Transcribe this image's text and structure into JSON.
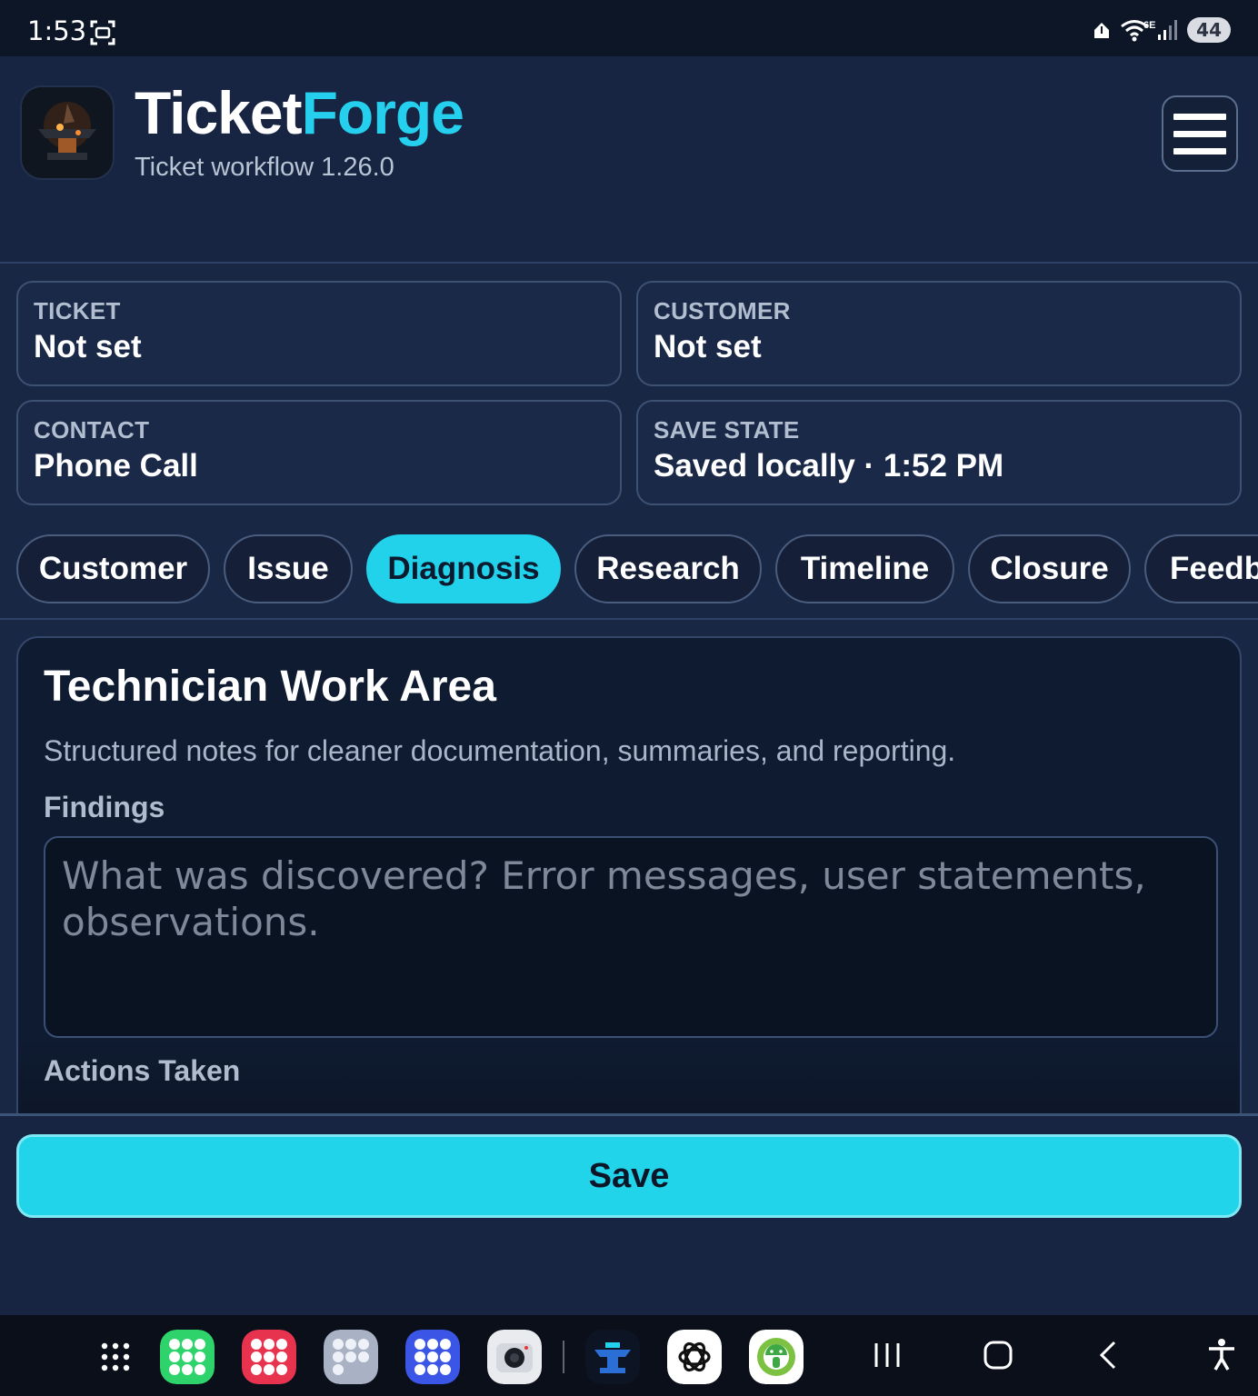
{
  "status_bar": {
    "time": "1:53",
    "network_label": "6E",
    "battery": "44"
  },
  "header": {
    "title_part1": "Ticket",
    "title_part2": "Forge",
    "subtitle": "Ticket workflow 1.26.0",
    "accent_color": "#25d0ee"
  },
  "info_cards": [
    {
      "label": "TICKET",
      "value": "Not set"
    },
    {
      "label": "CUSTOMER",
      "value": "Not set"
    },
    {
      "label": "CONTACT",
      "value": "Phone Call"
    },
    {
      "label": "SAVE STATE",
      "value": "Saved locally · 1:52 PM"
    }
  ],
  "tabs": [
    {
      "label": "Customer",
      "active": false
    },
    {
      "label": "Issue",
      "active": false
    },
    {
      "label": "Diagnosis",
      "active": true
    },
    {
      "label": "Research",
      "active": false
    },
    {
      "label": "Timeline",
      "active": false
    },
    {
      "label": "Closure",
      "active": false
    },
    {
      "label": "Feedb",
      "active": false
    }
  ],
  "panel": {
    "title": "Technician Work Area",
    "description": "Structured notes for cleaner documentation, summaries, and reporting.",
    "fields": [
      {
        "label": "Findings",
        "placeholder": "What was discovered? Error messages, user statements, observations."
      },
      {
        "label": "Actions Taken"
      }
    ]
  },
  "save_button": {
    "label": "Save"
  },
  "dock": {
    "apps": [
      "app-drawer-icon",
      "google-apps-folder-icon",
      "red-apps-folder-icon",
      "utilities-folder-icon",
      "social-apps-folder-icon",
      "camera-icon",
      "ticketforge-app-icon",
      "chatgpt-icon",
      "android-app-icon"
    ],
    "nav": [
      "recents-icon",
      "home-icon",
      "back-icon",
      "accessibility-icon"
    ]
  }
}
